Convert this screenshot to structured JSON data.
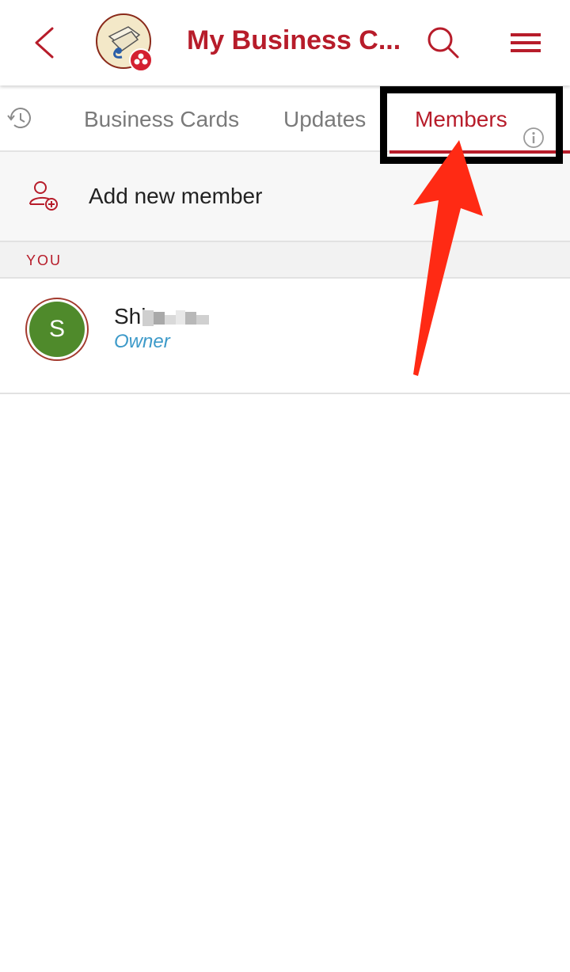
{
  "header": {
    "title": "My Business C..."
  },
  "tabs": {
    "cards_label": "Business Cards",
    "updates_label": "Updates",
    "members_label": "Members"
  },
  "actions": {
    "add_member_label": "Add new member"
  },
  "section": {
    "you_label": "YOU"
  },
  "member": {
    "initial": "S",
    "name": "Shi",
    "role": "Owner"
  },
  "icons": {
    "back": "chevron-left",
    "logo": "business-card-logo",
    "search": "search",
    "menu": "hamburger-menu",
    "history": "history",
    "info": "info",
    "add_member": "add-person"
  },
  "colors": {
    "brand": "#b71c2a",
    "tab_inactive": "#7a7a7a",
    "role": "#3d9ac9",
    "avatar": "#4f8a2b",
    "annotation_arrow": "#ff2a14",
    "annotation_box": "#000000"
  }
}
